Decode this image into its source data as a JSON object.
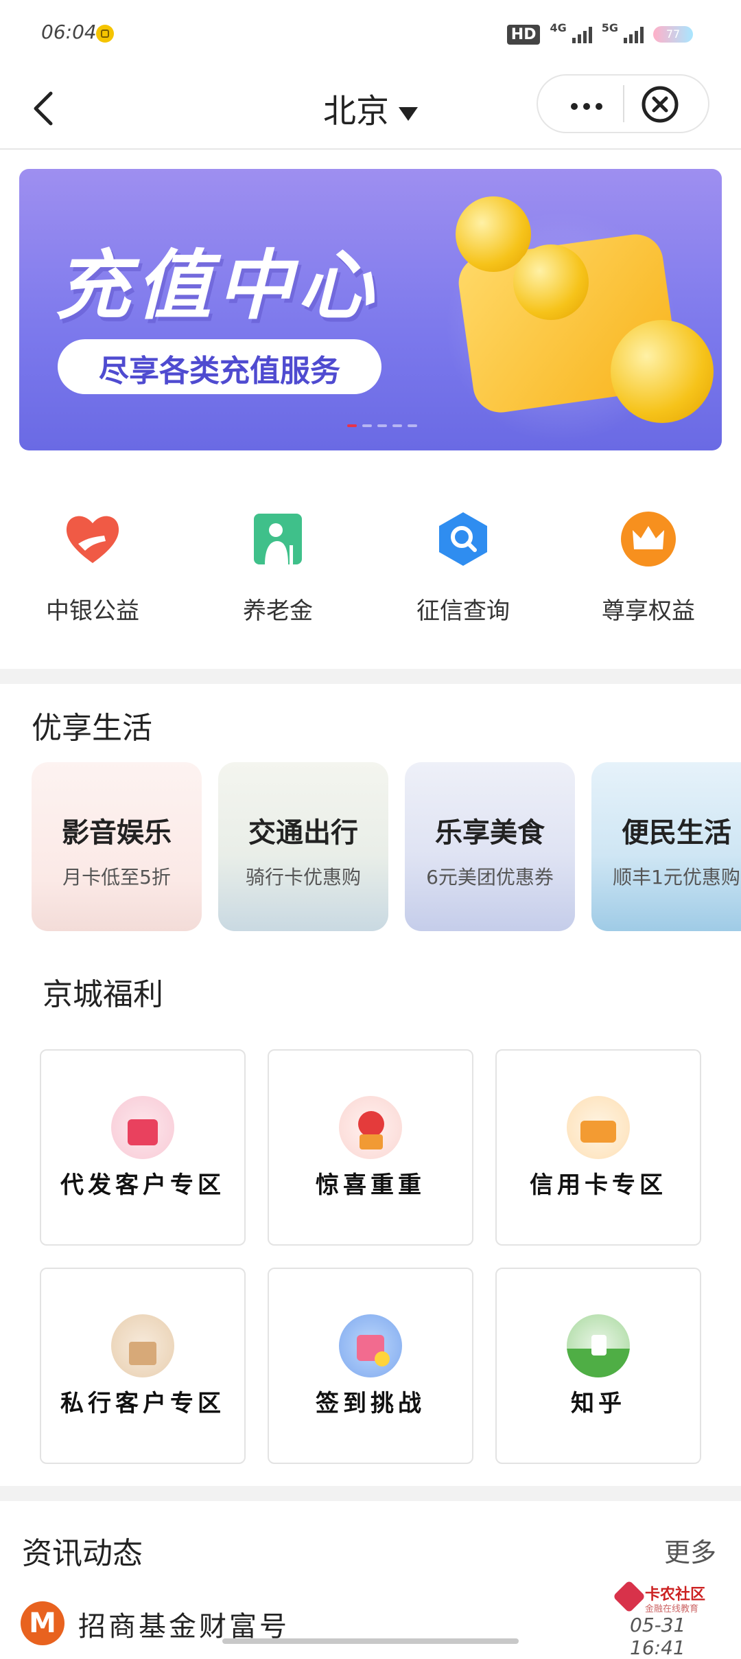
{
  "status_bar": {
    "time": "06:04",
    "hd": "HD",
    "net_4g": "4G",
    "net_5g": "5G",
    "battery": "77"
  },
  "nav": {
    "city": "北京"
  },
  "banner": {
    "title": "充值中心",
    "subtitle": "尽享各类充值服务",
    "page_count": 5,
    "active_page": 1
  },
  "shortcuts": [
    {
      "label": "中银公益",
      "icon": "heart-hand-icon"
    },
    {
      "label": "养老金",
      "icon": "elder-person-icon"
    },
    {
      "label": "征信查询",
      "icon": "magnifier-hexagon-icon"
    },
    {
      "label": "尊享权益",
      "icon": "crown-icon"
    }
  ],
  "life": {
    "title": "优享生活",
    "cards": [
      {
        "name": "影音娱乐",
        "desc": "月卡低至5折"
      },
      {
        "name": "交通出行",
        "desc": "骑行卡优惠购"
      },
      {
        "name": "乐享美食",
        "desc": "6元美团优惠券"
      },
      {
        "name": "便民生活",
        "desc": "顺丰1元优惠购"
      }
    ]
  },
  "welfare": {
    "title": "京城福利",
    "items": [
      {
        "label": "代发客户专区"
      },
      {
        "label": "惊喜重重"
      },
      {
        "label": "信用卡专区"
      },
      {
        "label": "私行客户专区"
      },
      {
        "label": "签到挑战"
      },
      {
        "label": "知乎"
      }
    ]
  },
  "news": {
    "title": "资讯动态",
    "more": "更多",
    "first_source": "招商基金财富号",
    "first_source_logo": "M"
  },
  "watermark": {
    "name": "卡农社区",
    "sub": "金融在线教育",
    "time": "05-31 16:41"
  },
  "colors": {
    "accent_red": "#e8334a",
    "banner_purple": "#7b78ec"
  }
}
